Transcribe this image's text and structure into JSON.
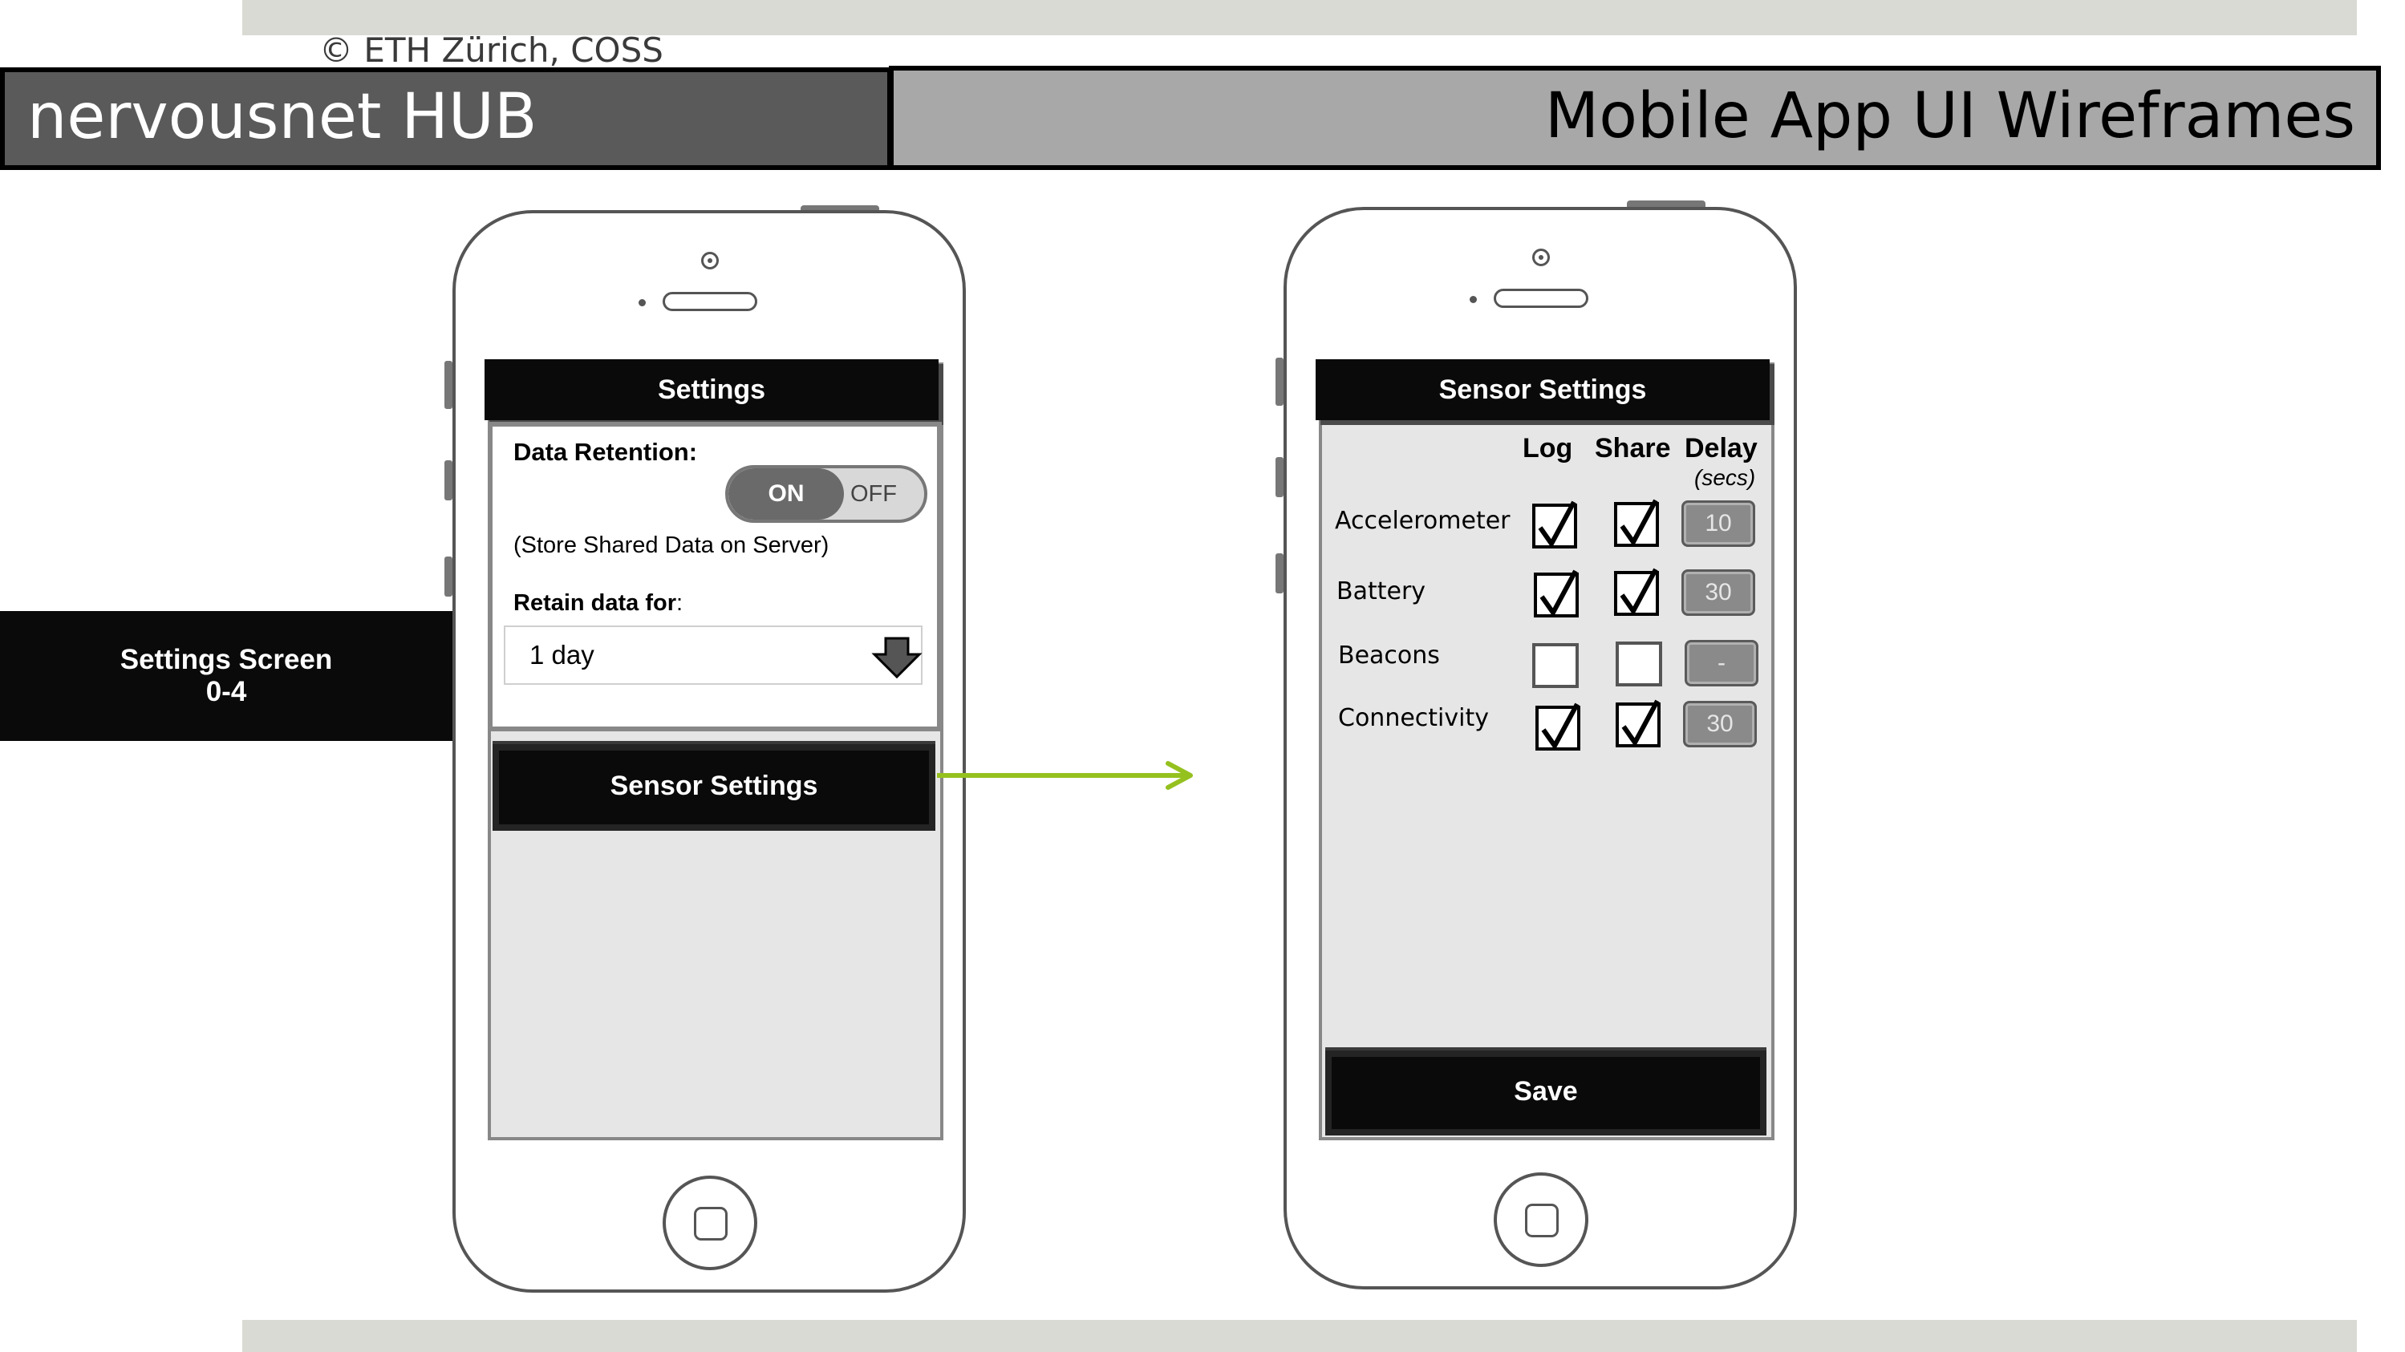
{
  "header": {
    "copyright": "© ETH Zürich, COSS",
    "left_title": "nervousnet HUB",
    "right_title": "Mobile App UI Wireframes"
  },
  "side_label": {
    "line1": "Settings Screen",
    "line2": "0-4"
  },
  "settings_screen": {
    "title": "Settings",
    "data_retention_label": "Data Retention:",
    "toggle_on": "ON",
    "toggle_off": "OFF",
    "toggle_state": "on",
    "store_note": "(Store Shared Data on Server)",
    "retain_label": "Retain data for",
    "retain_colon": ":",
    "retain_value": "1 day",
    "sensor_settings_button": "Sensor Settings"
  },
  "sensor_screen": {
    "title": "Sensor Settings",
    "columns": {
      "log": "Log",
      "share": "Share",
      "delay": "Delay",
      "delay_unit": "(secs)"
    },
    "rows": [
      {
        "name": "Accelerometer",
        "log": true,
        "share": true,
        "delay": "10"
      },
      {
        "name": "Battery",
        "log": true,
        "share": true,
        "delay": "30"
      },
      {
        "name": "Beacons",
        "log": false,
        "share": false,
        "delay": "-"
      },
      {
        "name": "Connectivity",
        "log": true,
        "share": true,
        "delay": "30"
      }
    ],
    "save_button": "Save"
  },
  "colors": {
    "arrow": "#95c11f",
    "band": "#d8dad3"
  },
  "icons": {
    "dropdown": "arrow-down-icon",
    "checkbox": "checkmark-icon"
  }
}
